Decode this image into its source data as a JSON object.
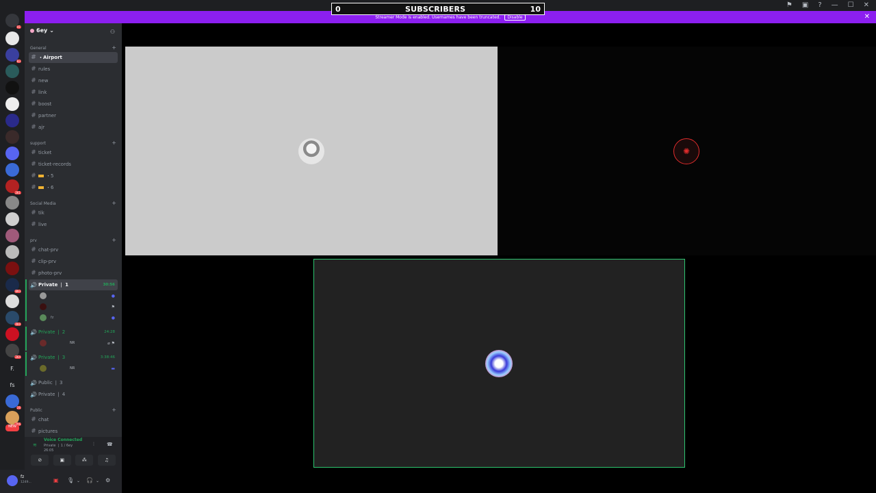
{
  "overlay": {
    "left_value": "0",
    "label": "SUBSCRIBERS",
    "right_value": "10"
  },
  "banner": {
    "text": "Streamer Mode is enabled. Usernames have been truncated.",
    "button": "Disable"
  },
  "server": {
    "name": "6ey"
  },
  "categories": {
    "general": "General",
    "support": "support",
    "social": "Social Media",
    "prv": "prv",
    "public": "Public"
  },
  "channels": {
    "airport": "・Airport",
    "rules": "rules",
    "new": "new",
    "link": "link",
    "boost": "boost",
    "partner": "partner",
    "ajr": "ajr",
    "ticket": "ticket",
    "ticket_records": "ticket-records",
    "five": "・5",
    "six": "・6",
    "tik": "tik",
    "live": "live",
    "chat_prv": "chat-prv",
    "clip_prv": "clip-prv",
    "photo_prv": "photo-prv",
    "private1": "Private ❘ 1",
    "private2": "Private ❘ 2",
    "private3": "Private ❘ 3",
    "public3": "Public ❘ 3",
    "private4": "Private ❘ 4",
    "chat": "chat",
    "pictures": "pictures"
  },
  "timers": {
    "private1": "30:56",
    "private2": "24:28",
    "private3": "3:38:46"
  },
  "voice_users": {
    "p1_u3": "fz",
    "p2_tag": "NR",
    "p3_tag": "NR"
  },
  "guild_badges": [
    "41",
    "83",
    "893",
    "261",
    "893",
    "460",
    "264",
    "26",
    "206",
    "NEW"
  ],
  "guild_letters": [
    "F.",
    "fs"
  ],
  "voice_panel": {
    "title": "Voice Connected",
    "channel": "Private ❘ 1 / 6ey",
    "time": "26:05"
  },
  "user": {
    "name": "fz",
    "status": "1249..."
  },
  "icons": {
    "speaker": "speaker-icon",
    "hash": "hash-icon"
  }
}
